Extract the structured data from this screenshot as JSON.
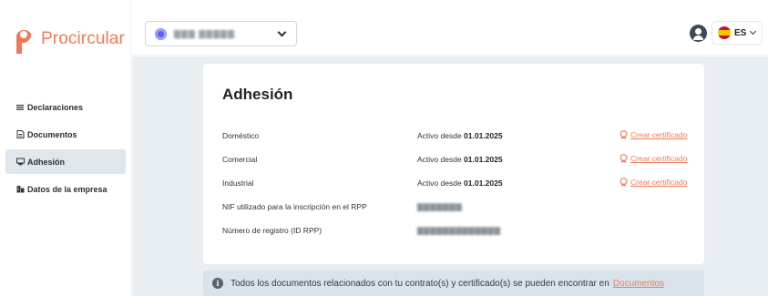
{
  "brand": {
    "name": "Procircular",
    "color": "#f07a57"
  },
  "sidebar": {
    "items": [
      {
        "label": "Declaraciones",
        "icon": "list-icon",
        "active": false
      },
      {
        "label": "Documentos",
        "icon": "document-icon",
        "active": false
      },
      {
        "label": "Adhesión",
        "icon": "contract-icon",
        "active": true
      },
      {
        "label": "Datos de la empresa",
        "icon": "building-icon",
        "active": false
      }
    ]
  },
  "topbar": {
    "org_name": "▇▇▇ ▇▇▇▇▇.",
    "language": "ES"
  },
  "card": {
    "title": "Adhesión",
    "rows": [
      {
        "label": "Doméstico",
        "status_prefix": "Activo desde",
        "date": "01.01.2025",
        "action": "Crear certificado"
      },
      {
        "label": "Comercial",
        "status_prefix": "Activo desde",
        "date": "01.01.2025",
        "action": "Crear certificado"
      },
      {
        "label": "Industrial",
        "status_prefix": "Activo desde",
        "date": "01.01.2025",
        "action": "Crear certificado"
      }
    ],
    "nif_label": "NIF utilizado para la inscripción en el RPP",
    "nif_value": "▇▇▇▇▇▇▇",
    "registro_label": "Número de registro (ID RPP)",
    "registro_value": "▇▇▇▇▇▇▇▇▇▇▇▇▇"
  },
  "banner": {
    "text": "Todos los documentos relacionados con tu contrato(s) y certificado(s) se pueden encontrar en",
    "link": "Documentos"
  }
}
